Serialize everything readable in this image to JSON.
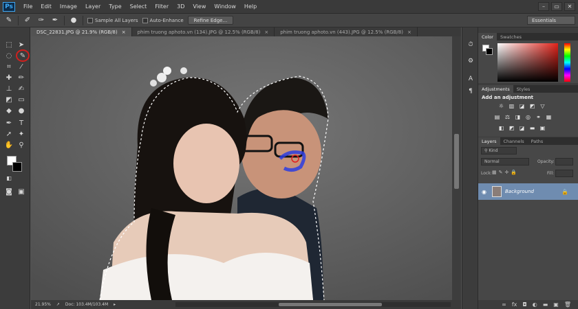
{
  "app": {
    "logo": "Ps",
    "menu": [
      "File",
      "Edit",
      "Image",
      "Layer",
      "Type",
      "Select",
      "Filter",
      "3D",
      "View",
      "Window",
      "Help"
    ],
    "window_controls": [
      "–",
      "▭",
      "✕"
    ]
  },
  "options": {
    "sample_all_layers": "Sample All Layers",
    "auto_enhance": "Auto-Enhance",
    "refine_edge": "Refine Edge...",
    "workspace": "Essentials"
  },
  "tabs": [
    {
      "label": "DSC_22831.JPG @ 21.9% (RGB/8)",
      "active": true
    },
    {
      "label": "phim truong aphoto.vn (134).JPG @ 12.5% (RGB/8)",
      "active": false
    },
    {
      "label": "phim truong aphoto.vn (443).JPG @ 12.5% (RGB/8)",
      "active": false
    }
  ],
  "status": {
    "zoom": "21.95%",
    "doc": "Doc: 103.4M/103.4M"
  },
  "panels": {
    "color_tabs": [
      "Color",
      "Swatches"
    ],
    "adjust_tabs": [
      "Adjustments",
      "Styles"
    ],
    "add_adjustment": "Add an adjustment",
    "layers_tabs": [
      "Layers",
      "Channels",
      "Paths"
    ],
    "kind": "Kind",
    "blend_mode": "Normal",
    "opacity_label": "Opacity:",
    "lock_label": "Lock:",
    "fill_label": "Fill:",
    "layer_name": "Background"
  },
  "colors": {
    "foreground": "#ffffff",
    "background": "#000000",
    "highlight": "#d0201e",
    "selected_layer": "#6f8cb0"
  }
}
